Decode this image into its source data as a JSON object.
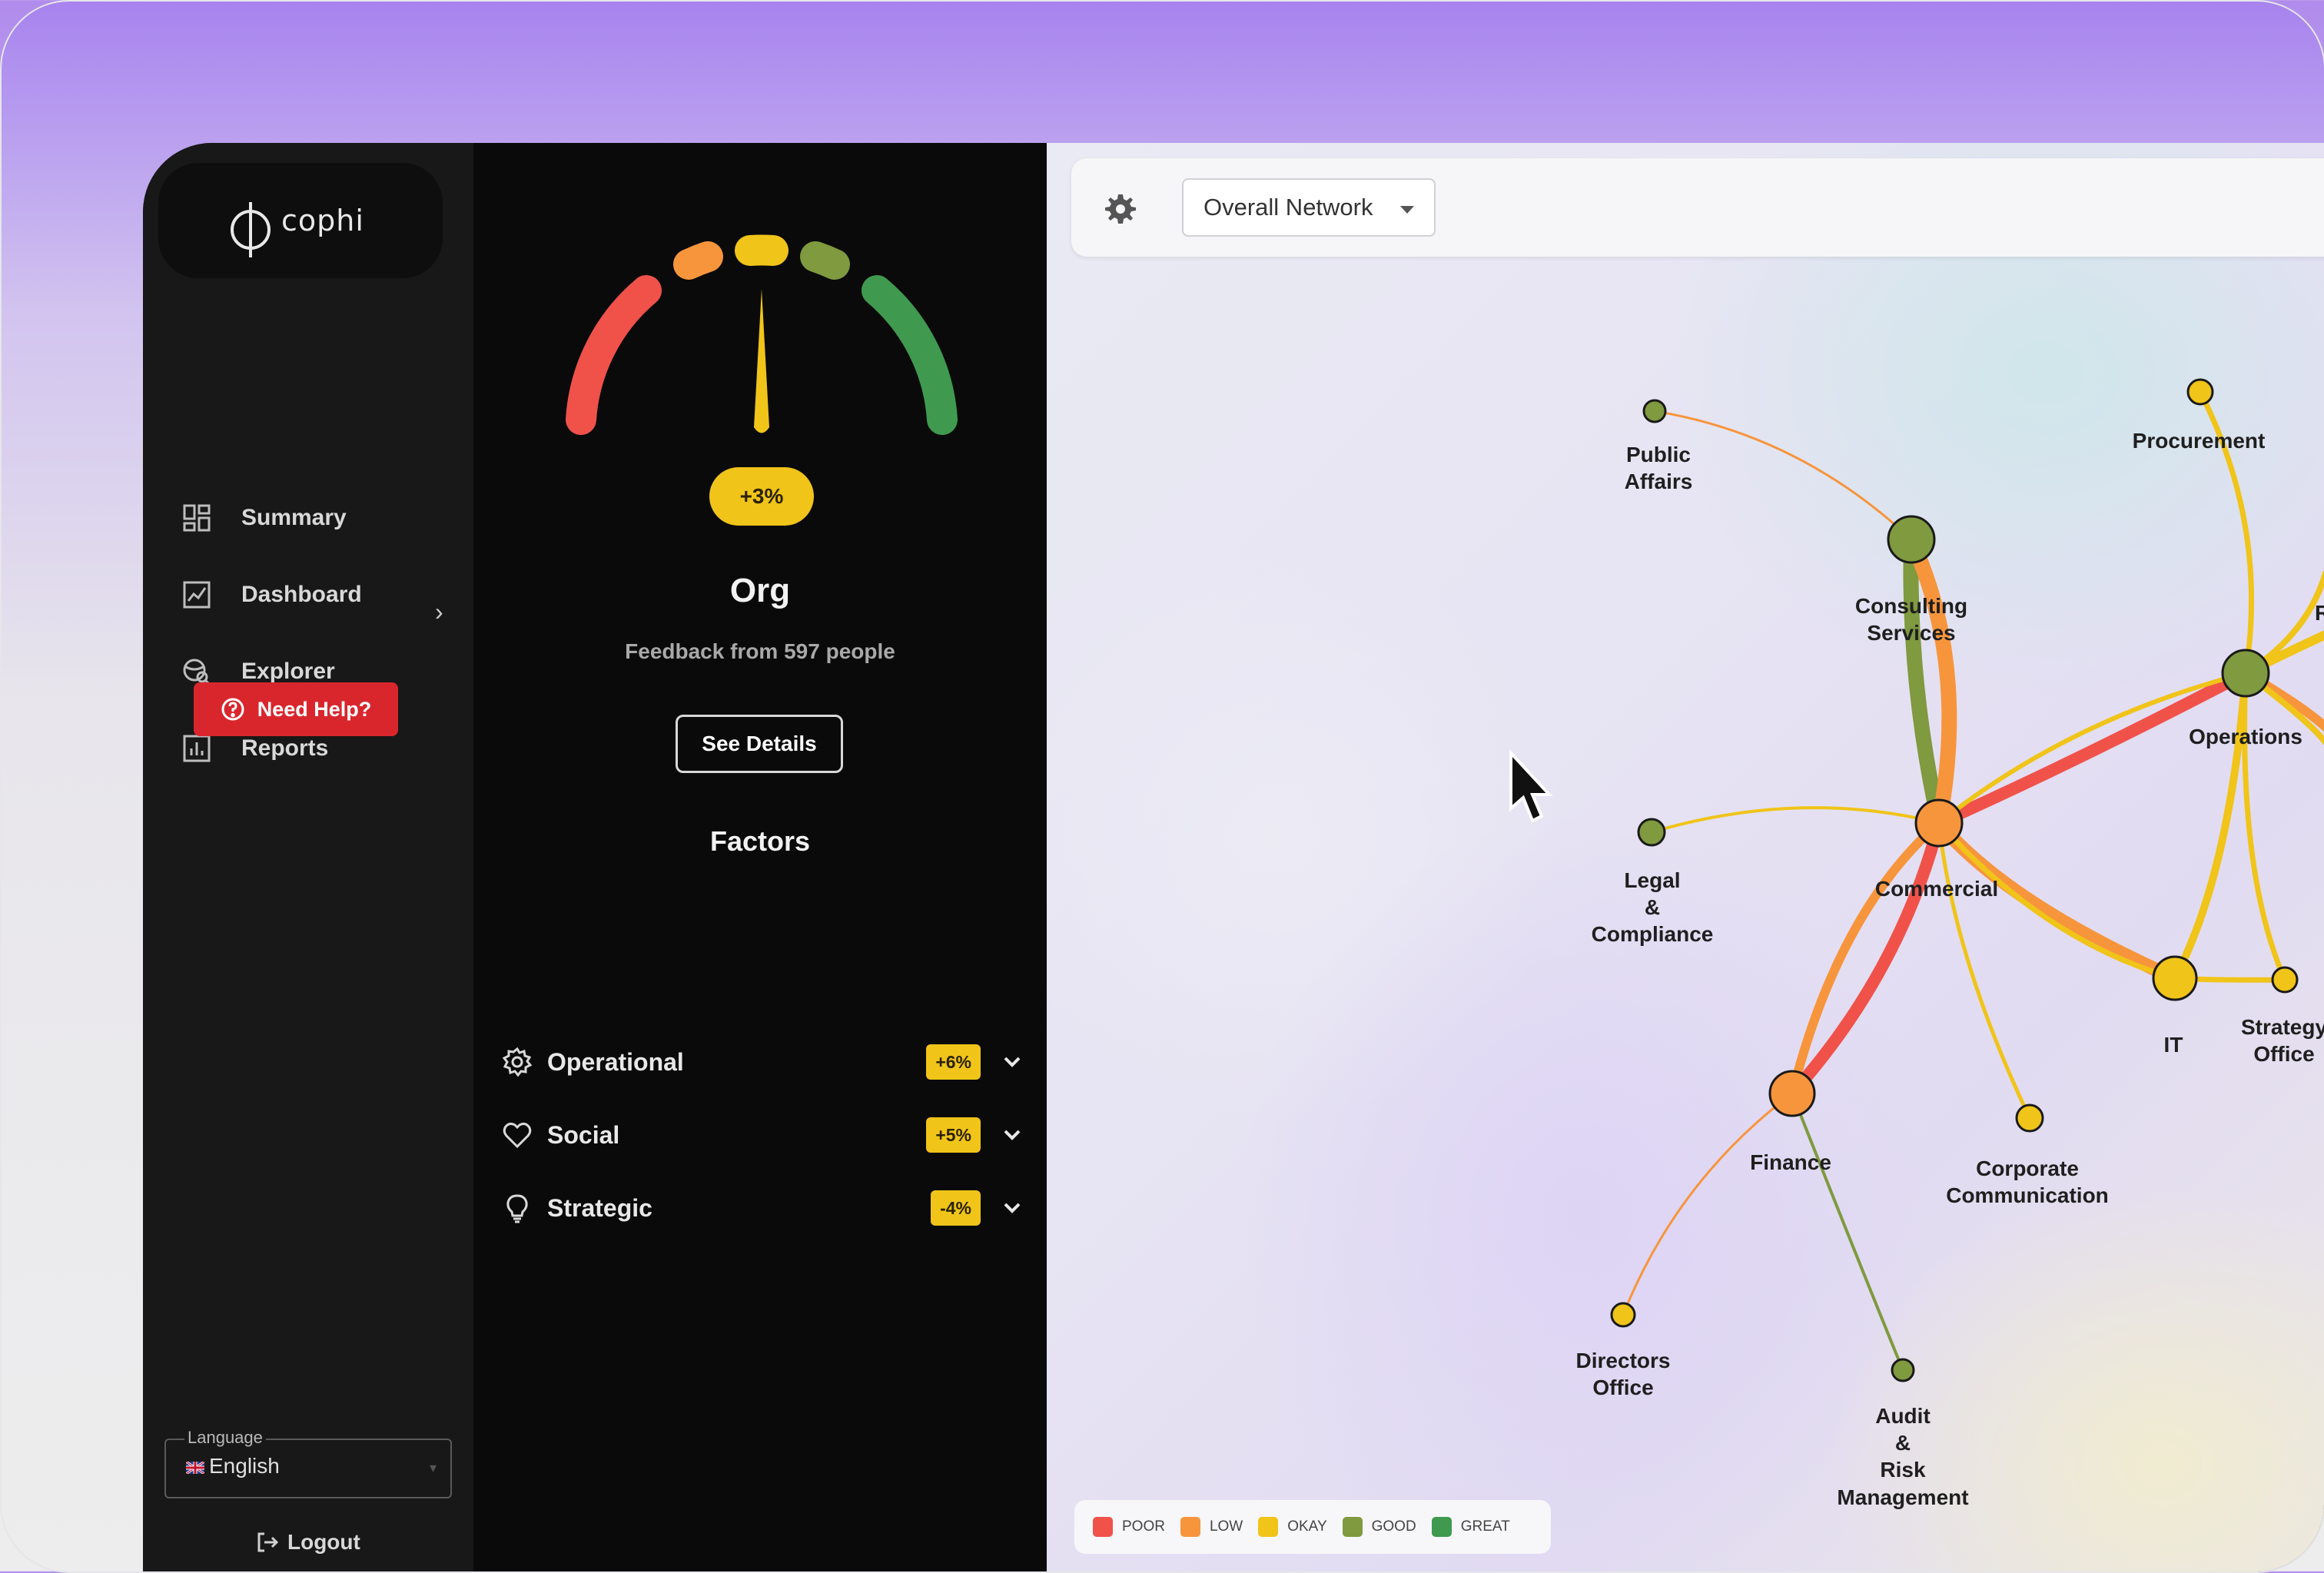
{
  "brand": {
    "name": "cophi"
  },
  "nav": [
    {
      "label": "Summary",
      "icon": "grid-icon"
    },
    {
      "label": "Dashboard",
      "icon": "chart-line-icon"
    },
    {
      "label": "Explorer",
      "icon": "globe-search-icon"
    },
    {
      "label": "Reports",
      "icon": "bar-chart-icon"
    }
  ],
  "help": {
    "label": "Need Help?"
  },
  "language": {
    "label": "Language",
    "value": "English"
  },
  "logout": {
    "label": "Logout"
  },
  "gauge": {
    "change": "+3%",
    "level": "OKAY"
  },
  "org": {
    "title": "Org",
    "feedback": "Feedback from 597 people",
    "details_label": "See Details"
  },
  "factors": {
    "title": "Factors",
    "items": [
      {
        "label": "Operational",
        "change": "+6%"
      },
      {
        "label": "Social",
        "change": "+5%"
      },
      {
        "label": "Strategic",
        "change": "-4%"
      }
    ]
  },
  "network": {
    "view_select": "Overall Network",
    "nodes": [
      {
        "label": "Public Affairs",
        "level": "GOOD"
      },
      {
        "label": "Procurement",
        "level": "OKAY"
      },
      {
        "label": "Consulting Services",
        "level": "GOOD"
      },
      {
        "label": "Operations",
        "level": "GOOD"
      },
      {
        "label": "Legal & Compliance",
        "level": "GOOD"
      },
      {
        "label": "Commercial",
        "level": "LOW"
      },
      {
        "label": "IT",
        "level": "OKAY"
      },
      {
        "label": "Strategy Office",
        "level": "OKAY"
      },
      {
        "label": "Finance",
        "level": "LOW"
      },
      {
        "label": "Corporate Communication",
        "level": "OKAY"
      },
      {
        "label": "Directors Office",
        "level": "OKAY"
      },
      {
        "label": "Audit & Risk Management",
        "level": "GOOD"
      },
      {
        "label": "R",
        "level": ""
      }
    ]
  },
  "legend": [
    {
      "label": "POOR",
      "color": "#f0524a"
    },
    {
      "label": "LOW",
      "color": "#f7953c"
    },
    {
      "label": "OKAY",
      "color": "#f0c419"
    },
    {
      "label": "GOOD",
      "color": "#7f9a3f"
    },
    {
      "label": "GREAT",
      "color": "#3f9a4f"
    }
  ]
}
